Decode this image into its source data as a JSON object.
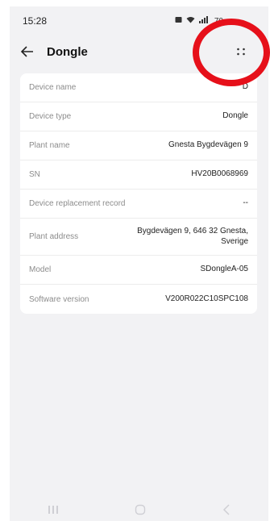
{
  "status_bar": {
    "time": "15:28",
    "icons": [
      "notification-icon",
      "wifi-icon",
      "signal-icon"
    ],
    "battery_text": "70"
  },
  "header": {
    "back_icon": "arrow-left-icon",
    "title": "Dongle",
    "more_icon": "more-dots-icon"
  },
  "details": [
    {
      "label": "Device name",
      "value": "D"
    },
    {
      "label": "Device type",
      "value": "Dongle"
    },
    {
      "label": "Plant name",
      "value": "Gnesta Bygdevägen 9"
    },
    {
      "label": "SN",
      "value": "HV20B0068969"
    },
    {
      "label": "Device replacement record",
      "value": "--"
    },
    {
      "label": "Plant address",
      "value": "Bygdevägen 9, 646 32 Gnesta, Sverige"
    },
    {
      "label": "Model",
      "value": "SDongleA-05"
    },
    {
      "label": "Software version",
      "value": "V200R022C10SPC108"
    }
  ],
  "nav_bar": {
    "icons": [
      "recent-apps-icon",
      "home-icon",
      "back-nav-icon"
    ]
  },
  "colors": {
    "background": "#f2f2f4",
    "card": "#ffffff",
    "annotation": "#e6101a"
  }
}
